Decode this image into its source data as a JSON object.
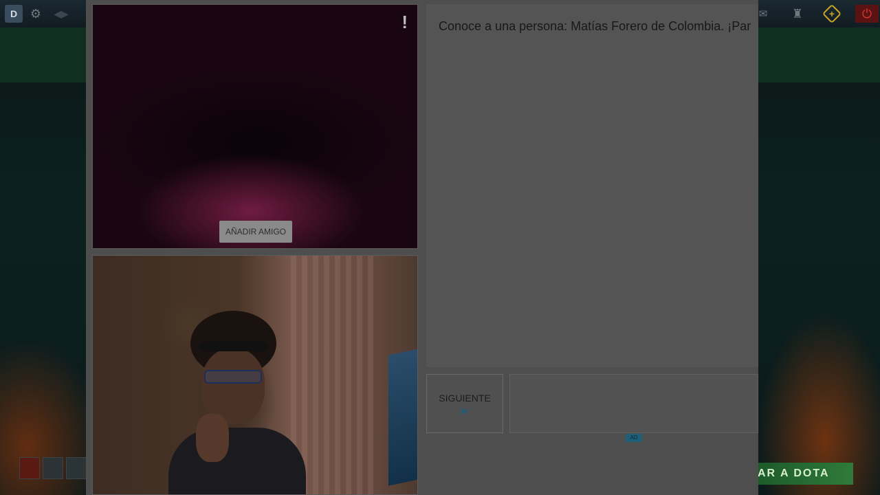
{
  "game": {
    "play_button_label": "AR A DOTA"
  },
  "chat": {
    "intro_text": "Conoce a una persona: Matías Forero de Colombia. ¡Par",
    "add_friend_label": "AÑADIR AMIGO",
    "report_label": "!",
    "next_label": "SIGUIENTE",
    "next_key_label": "|▶|",
    "message_placeholder": "",
    "ad_label": "AD"
  },
  "colors": {
    "overlay": "#4e4e4e",
    "play_button": "#2f7a3a",
    "power_button": "#d63a2a",
    "plus_button": "#c9a428"
  }
}
